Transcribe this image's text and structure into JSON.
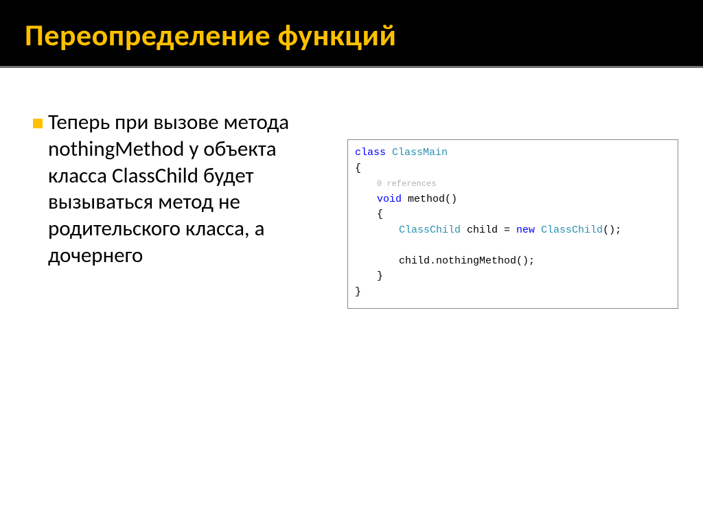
{
  "title": "Переопределение функций",
  "bullet": "Теперь при вызове метода nothingMethod у объекта класса ClassChild будет вызываться метод не родительского класса, а дочернего",
  "code": {
    "l1_kw": "class",
    "l1_typ": " ClassMain",
    "l2": "{",
    "l3_ref": "0 references",
    "l4_kw": "void",
    "l4_rest": " method()",
    "l5": "{",
    "l6_typ1": "ClassChild",
    "l6_mid": " child = ",
    "l6_kw": "new",
    "l6_typ2": " ClassChild",
    "l6_end": "();",
    "l7": "child.nothingMethod();",
    "l8": "}",
    "l9": "}"
  }
}
